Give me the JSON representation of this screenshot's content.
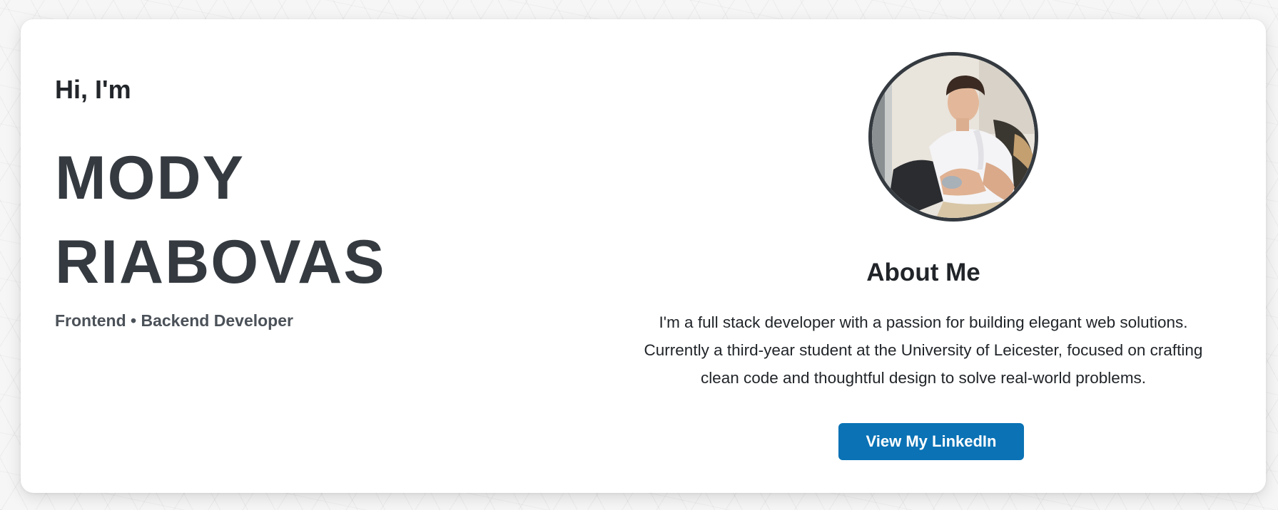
{
  "hero": {
    "greeting": "Hi, I'm",
    "name_line1": "MODY",
    "name_line2": "RIABOVAS",
    "subtitle": "Frontend • Backend Developer"
  },
  "about": {
    "title": "About Me",
    "paragraph_lines": [
      "I'm a full stack developer with a passion for building elegant web solutions.",
      "Currently a third-year student at the University of Leicester, focused on crafting",
      "clean code and thoughtful design to solve real-world problems."
    ],
    "button_label": "View My LinkedIn"
  },
  "colors": {
    "accent": "#0a72b5",
    "heading": "#343a40",
    "text": "#212529"
  }
}
